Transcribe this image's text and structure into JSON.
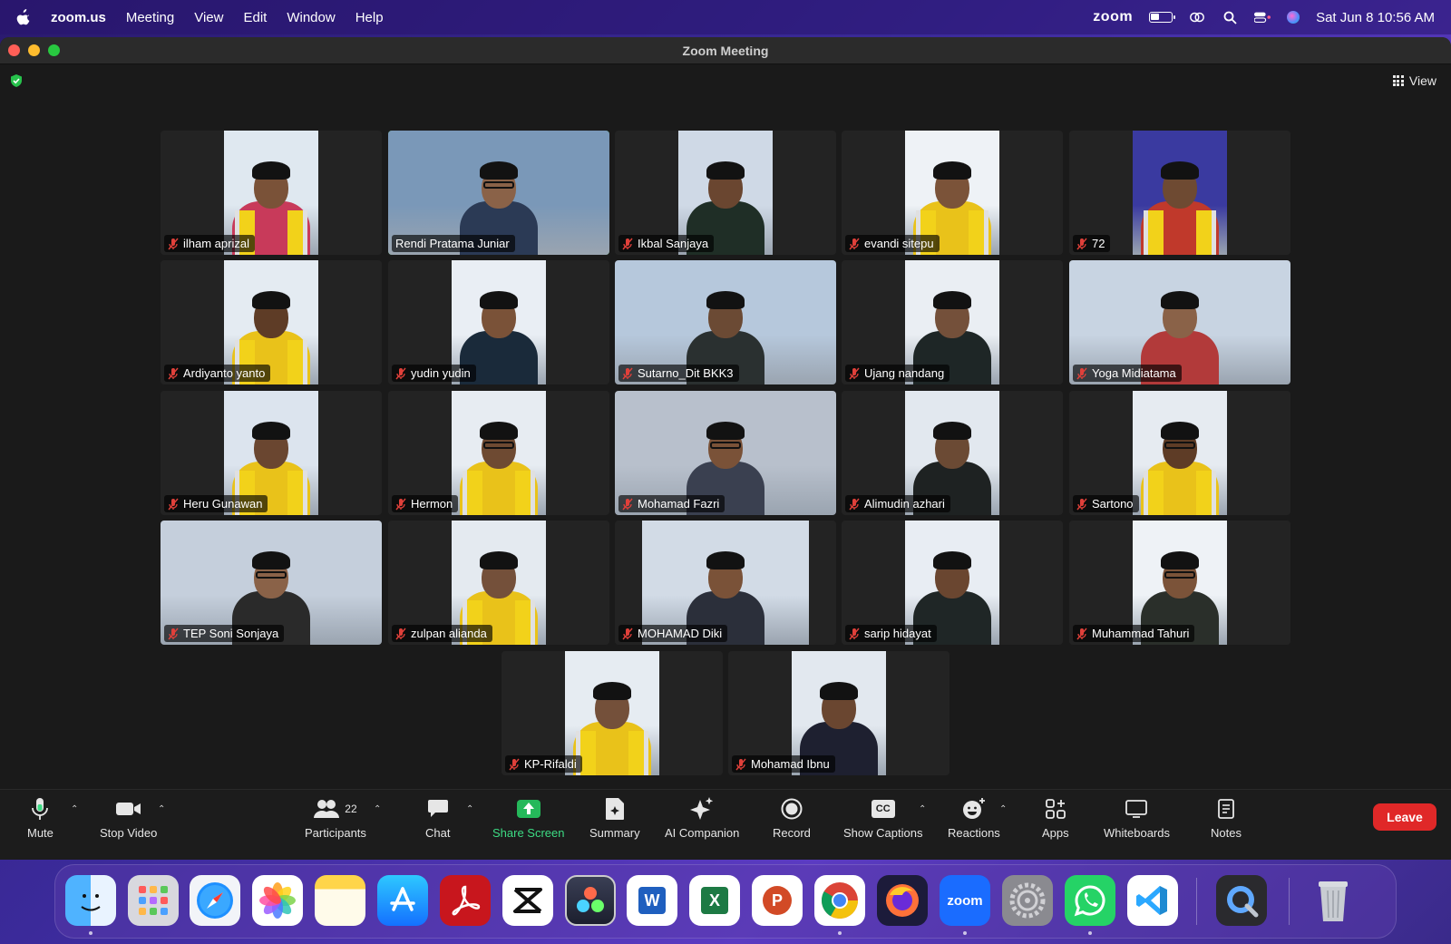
{
  "menubar": {
    "app": "zoom.us",
    "items": [
      "Meeting",
      "View",
      "Edit",
      "Window",
      "Help"
    ],
    "zoom_brand": "zoom",
    "datetime": "Sat Jun 8  10:56 AM"
  },
  "window": {
    "title": "Zoom Meeting",
    "view_label": "View"
  },
  "participants": [
    {
      "name": "ilham aprizal",
      "muted": true
    },
    {
      "name": "Rendi Pratama Juniar",
      "muted": false,
      "active_speaker": true
    },
    {
      "name": "Ikbal Sanjaya",
      "muted": true
    },
    {
      "name": "evandi sitepu",
      "muted": true
    },
    {
      "name": "72",
      "muted": true
    },
    {
      "name": "Ardiyanto yanto",
      "muted": true
    },
    {
      "name": "yudin yudin",
      "muted": true
    },
    {
      "name": "Sutarno_Dit BKK3",
      "muted": true
    },
    {
      "name": "Ujang nandang",
      "muted": true
    },
    {
      "name": "Yoga Midiatama",
      "muted": true
    },
    {
      "name": "Heru Gunawan",
      "muted": true
    },
    {
      "name": "Hermon",
      "muted": true
    },
    {
      "name": "Mohamad Fazri",
      "muted": true
    },
    {
      "name": "Alimudin azhari",
      "muted": true
    },
    {
      "name": "Sartono",
      "muted": true
    },
    {
      "name": "TEP Soni Sonjaya",
      "muted": true
    },
    {
      "name": "zulpan alianda",
      "muted": true
    },
    {
      "name": "MOHAMAD Diki",
      "muted": true
    },
    {
      "name": "sarip hidayat",
      "muted": true
    },
    {
      "name": "Muhammad Tahuri",
      "muted": true
    },
    {
      "name": "KP-Rifaldi",
      "muted": true
    },
    {
      "name": "Mohamad Ibnu",
      "muted": true
    }
  ],
  "toolbar": {
    "mute": "Mute",
    "stop_video": "Stop Video",
    "participants": "Participants",
    "participant_count": "22",
    "chat": "Chat",
    "share_screen": "Share Screen",
    "summary": "Summary",
    "ai_companion": "AI Companion",
    "record": "Record",
    "show_captions": "Show Captions",
    "captions_badge": "CC",
    "reactions": "Reactions",
    "apps": "Apps",
    "whiteboards": "Whiteboards",
    "notes": "Notes",
    "leave": "Leave"
  },
  "dock": {
    "apps": [
      "Finder",
      "Launchpad",
      "Safari",
      "Photos",
      "Notes",
      "App Store",
      "Acrobat",
      "CapCut",
      "DaVinci Resolve",
      "Word",
      "Excel",
      "PowerPoint",
      "Chrome",
      "Firefox",
      "Zoom",
      "System Settings",
      "WhatsApp",
      "VS Code",
      "QuickTime",
      "Trash"
    ],
    "word_badge": "W",
    "excel_badge": "X",
    "powerpoint_badge": "P",
    "zoom_badge": "zoom"
  },
  "colors": {
    "active_speaker": "#2ecc40",
    "leave": "#e02828",
    "share_screen": "#3ddc84",
    "muted_icon": "#e0403a"
  }
}
